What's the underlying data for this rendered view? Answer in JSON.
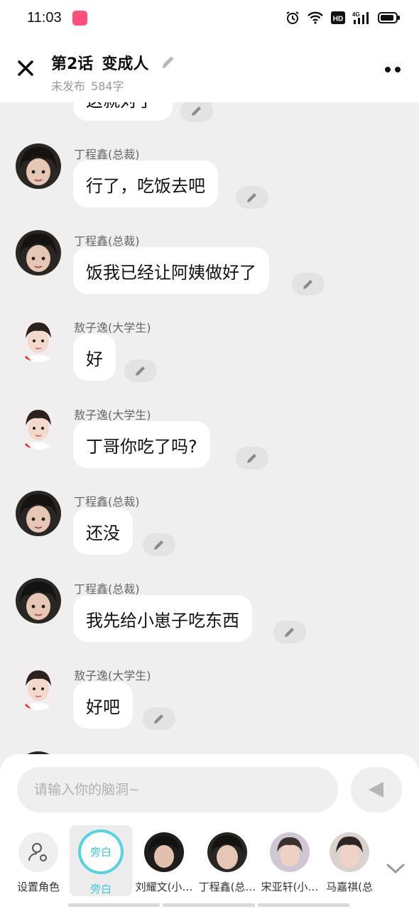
{
  "status_bar": {
    "time": "11:03",
    "network": "4G",
    "hd": "HD"
  },
  "header": {
    "chapter": "第2话",
    "chapter_name": "变成人",
    "status": "未发布",
    "word_count": "584字"
  },
  "chat": {
    "partial_text": "这就对了",
    "messages": [
      {
        "sender": "丁程鑫(总裁)",
        "text": "行了，吃饭去吧",
        "avatar": "dingchengxin"
      },
      {
        "sender": "丁程鑫(总裁)",
        "text": "饭我已经让阿姨做好了",
        "avatar": "dingchengxin"
      },
      {
        "sender": "敖子逸(大学生)",
        "text": "好",
        "avatar": "aoziyi"
      },
      {
        "sender": "敖子逸(大学生)",
        "text": "丁哥你吃了吗?",
        "avatar": "aoziyi"
      },
      {
        "sender": "丁程鑫(总裁)",
        "text": "还没",
        "avatar": "dingchengxin"
      },
      {
        "sender": "丁程鑫(总裁)",
        "text": "我先给小崽子吃东西",
        "avatar": "dingchengxin"
      },
      {
        "sender": "敖子逸(大学生)",
        "text": "好吧",
        "avatar": "aoziyi"
      }
    ]
  },
  "composer": {
    "placeholder": "请输入你的脑洞~"
  },
  "roles": {
    "set_role_label": "设置角色",
    "narrator_badge": "旁白",
    "narrator_label": "旁白",
    "characters": [
      {
        "label": "刘耀文(小…"
      },
      {
        "label": "丁程鑫(总…"
      },
      {
        "label": "宋亚轩(小…"
      },
      {
        "label": "马嘉祺(总"
      }
    ]
  },
  "colors": {
    "accent": "#3fc9d8",
    "background": "#efefef",
    "bubble": "#ffffff"
  }
}
